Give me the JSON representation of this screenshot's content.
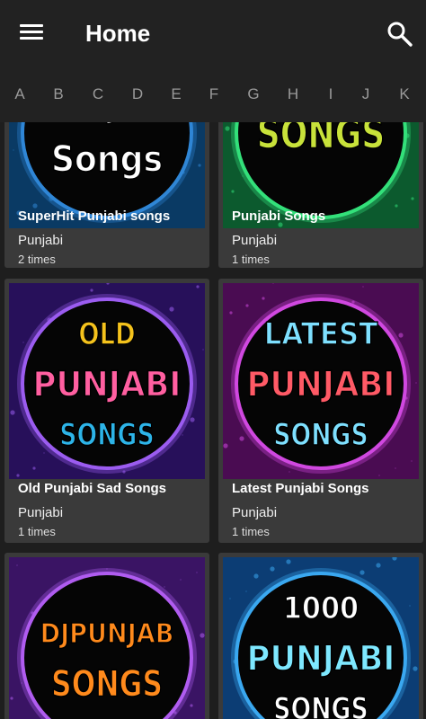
{
  "appbar": {
    "title": "Home",
    "menu_icon": "menu-icon",
    "search_icon": "search-icon"
  },
  "alphabet": [
    "A",
    "B",
    "C",
    "D",
    "E",
    "F",
    "G",
    "H",
    "I",
    "J",
    "K"
  ],
  "cards": [
    {
      "title": "SuperHit Punjabi songs",
      "category": "Punjabi",
      "count": "2 times",
      "art": {
        "lines": [
          "PUNJABI",
          "Songs"
        ],
        "colors": [
          "#ffffff",
          "#ffffff"
        ],
        "ring": "#2f86d6",
        "bg": "#0a3a64"
      }
    },
    {
      "title": "Punjabi Songs",
      "category": "Punjabi",
      "count": "1 times",
      "art": {
        "lines": [
          "SONGS"
        ],
        "colors": [
          "#c8e23a"
        ],
        "ring": "#33e07a",
        "bg": "#0c5a2e"
      }
    },
    {
      "title": "Old Punjabi Sad Songs",
      "category": "Punjabi",
      "count": "1 times",
      "art": {
        "lines": [
          "OLD",
          "PUNJABI",
          "SONGS"
        ],
        "colors": [
          "#f4c21c",
          "#ff5fa0",
          "#2db4e8"
        ],
        "ring": "#9b5cf0",
        "bg": "#27105a"
      }
    },
    {
      "title": "Latest Punjabi Songs",
      "category": "Punjabi",
      "count": "1 times",
      "art": {
        "lines": [
          "LATEST",
          "PUNJABI",
          "SONGS"
        ],
        "colors": [
          "#7ee0ff",
          "#ff5a66",
          "#7ee0ff"
        ],
        "ring": "#d048e0",
        "bg": "#4a0c52"
      }
    },
    {
      "title": "DJPUNJAB",
      "category": "",
      "count": "",
      "art": {
        "lines": [
          "DJPUNJAB",
          "SONGS"
        ],
        "colors": [
          "#ff8a1c",
          "#ff8a1c"
        ],
        "ring": "#b05cf0",
        "bg": "#3a1464"
      }
    },
    {
      "title": "1000 PUNJABI",
      "category": "",
      "count": "",
      "art": {
        "lines": [
          "1000",
          "PUNJABI",
          "SONGS"
        ],
        "colors": [
          "#ffffff",
          "#7ee8ff",
          "#ffffff"
        ],
        "ring": "#3aa8f0",
        "bg": "#0c3d74"
      }
    }
  ]
}
